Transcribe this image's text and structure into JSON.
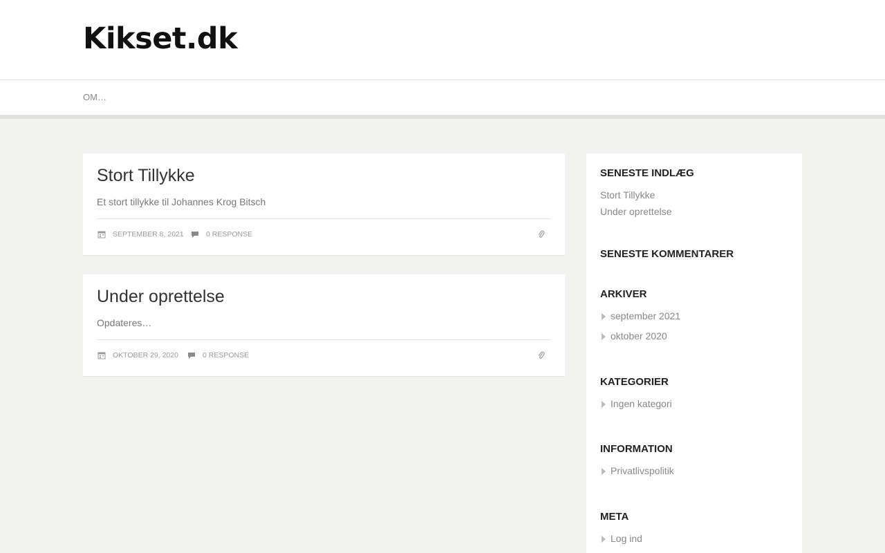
{
  "site": {
    "title": "Kikset.dk"
  },
  "nav": {
    "items": [
      {
        "label": "OM…"
      }
    ]
  },
  "posts": [
    {
      "title": "Stort Tillykke",
      "excerpt": "Et stort tillykke til Johannes Krog Bitsch",
      "date": "SEPTEMBER 8, 2021",
      "responses": "0 RESPONSE"
    },
    {
      "title": "Under oprettelse",
      "excerpt": "Opdateres…",
      "date": "OKTOBER 29, 2020",
      "responses": "0 RESPONSE"
    }
  ],
  "sidebar": {
    "recent_posts": {
      "title": "SENESTE INDLÆG",
      "items": [
        "Stort Tillykke",
        "Under oprettelse"
      ]
    },
    "recent_comments": {
      "title": "SENESTE KOMMENTARER"
    },
    "archives": {
      "title": "ARKIVER",
      "items": [
        "september 2021",
        "oktober 2020"
      ]
    },
    "categories": {
      "title": "KATEGORIER",
      "items": [
        "Ingen kategori"
      ]
    },
    "information": {
      "title": "INFORMATION",
      "items": [
        "Privatlivspolitik"
      ]
    },
    "meta": {
      "title": "META",
      "items": [
        "Log ind"
      ]
    }
  },
  "icons": {
    "calendar": "calendar-icon",
    "comment": "comment-icon",
    "link": "paperclip-icon"
  },
  "colors": {
    "background": "#f2f2f0",
    "panel": "#ffffff",
    "title": "#111111",
    "muted": "#888888"
  }
}
